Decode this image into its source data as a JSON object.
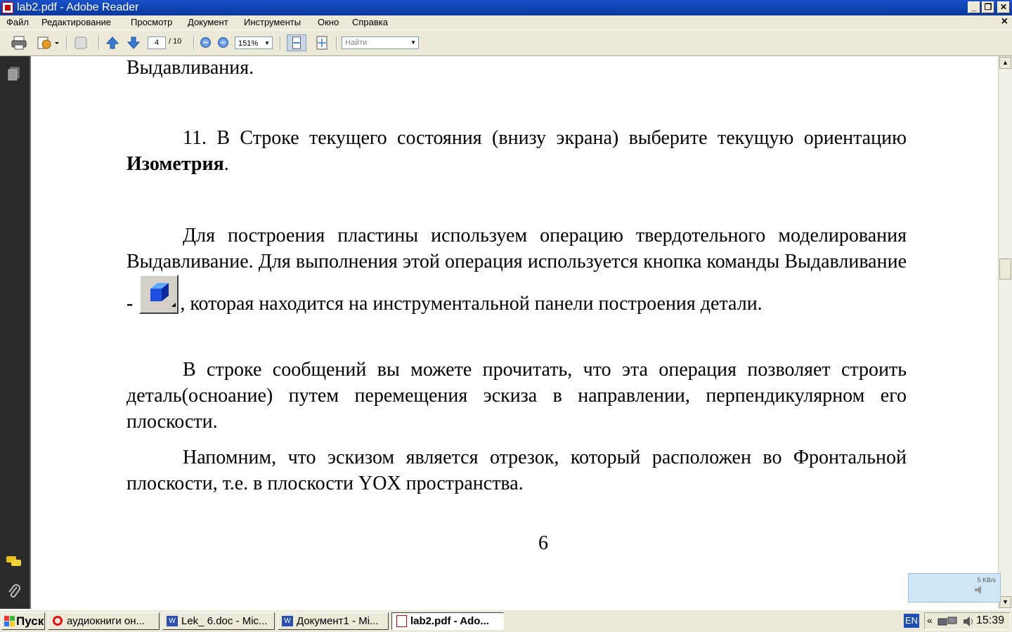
{
  "window": {
    "title": "lab2.pdf - Adobe Reader",
    "minimize": "_",
    "restore": "❐",
    "close": "✕"
  },
  "menu": {
    "items": [
      "Файл",
      "Редактирование",
      "Просмотр",
      "Документ",
      "Инструменты",
      "Окно",
      "Справка"
    ],
    "close_doc": "×"
  },
  "toolbar": {
    "page_current": "4",
    "page_total": "/ 10",
    "zoom": "151%",
    "find_placeholder": "Найти"
  },
  "document": {
    "line0": "Выдавливания.",
    "p11_a": "11. В Строке текущего состояния (внизу экрана) выберите текущую ориентацию ",
    "p11_bold": "Изометрия",
    "p11_end": ".",
    "p2_a": "Для построения пластины используем операцию твердотельного моделирования Выдавливание. Для выполнения этой операция используется кнопка команды Выдавливание ",
    "p2_dash": "-",
    "p2_b": ", которая находится на инструментальной панели построения детали.",
    "p3": "В строке сообщений вы можете прочитать, что эта операция позволяет строить деталь(осноание) путем перемещения эскиза в направлении, перпендикулярном его плоскости.",
    "p4": "Напомним, что эскизом является отрезок, который расположен во Фронтальной плоскости, т.е. в плоскости YOX пространства.",
    "page_number": "6"
  },
  "widget": {
    "speed": "5 KB/s"
  },
  "taskbar": {
    "start": "Пуск",
    "tasks": [
      "аудиокниги он...",
      "Lek_ 6.doc - Mic...",
      "Документ1 - Mi...",
      "lab2.pdf - Ado..."
    ],
    "lang": "EN",
    "tray_arrows": "«",
    "clock": "15:39"
  }
}
